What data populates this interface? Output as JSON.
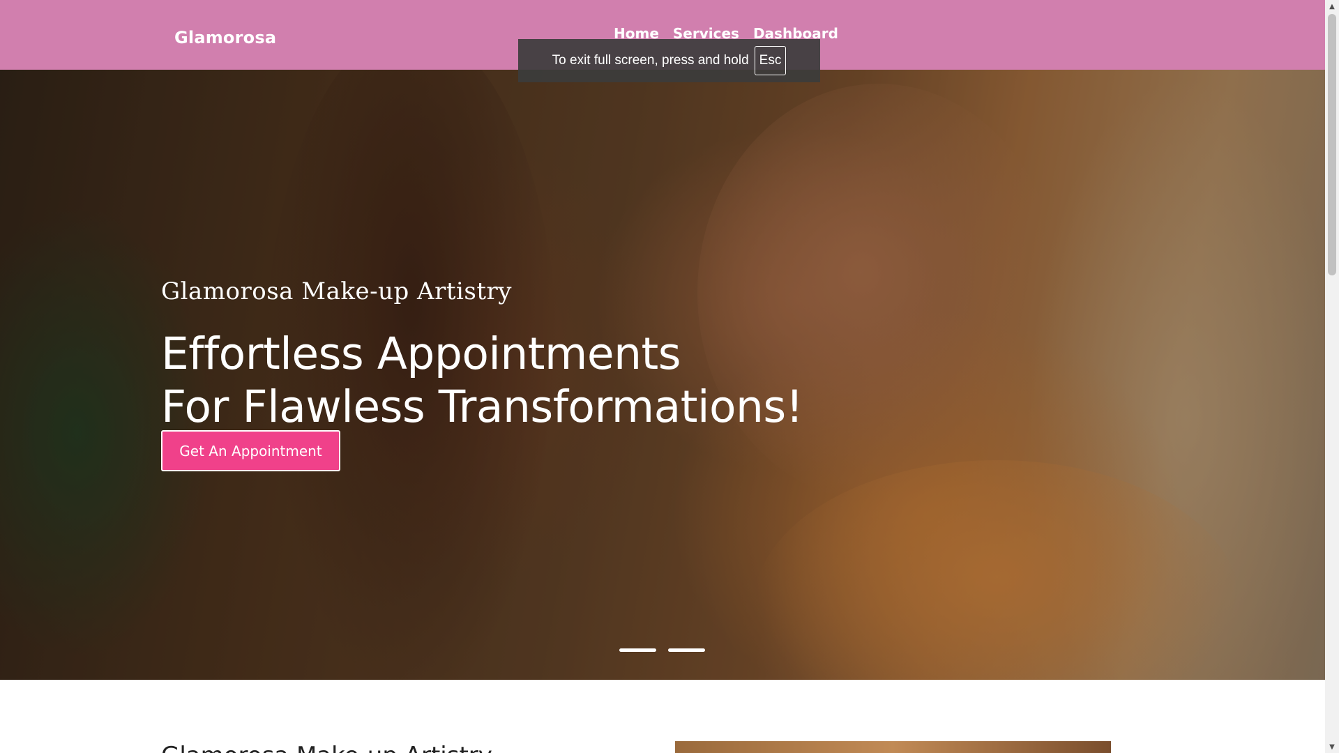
{
  "header": {
    "brand": "Glamorosa",
    "nav": [
      {
        "label": "Home"
      },
      {
        "label": "Services"
      },
      {
        "label": "Dashboard"
      }
    ],
    "background_color": "#d17fae"
  },
  "fullscreen_notice": {
    "message": "To exit full screen, press and hold",
    "key": "Esc"
  },
  "hero": {
    "kicker": "Glamorosa Make-up Artistry",
    "headline_line1": "Effortless Appointments",
    "headline_line2": "For Flawless Transformations!",
    "cta_label": "Get An Appointment",
    "cta_color": "#f0418a",
    "slides_count": 2
  },
  "lower_section": {
    "title": "Glamorosa Make-up Artistry"
  },
  "scrollbar": {
    "up_icon": "triangle-up",
    "down_icon": "triangle-down"
  }
}
